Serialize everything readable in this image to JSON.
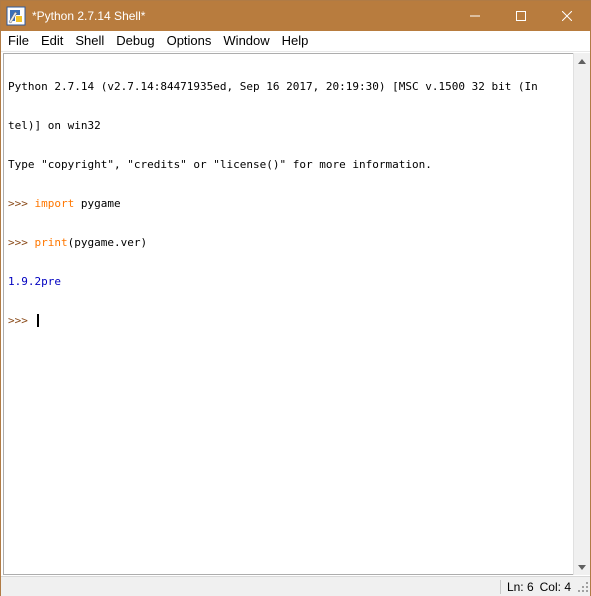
{
  "window": {
    "title": "*Python 2.7.14 Shell*",
    "titlebar_color": "#b87c3e"
  },
  "menu": {
    "items": [
      "File",
      "Edit",
      "Shell",
      "Debug",
      "Options",
      "Window",
      "Help"
    ]
  },
  "shell": {
    "banner_line1": "Python 2.7.14 (v2.7.14:84471935ed, Sep 16 2017, 20:19:30) [MSC v.1500 32 bit (In",
    "banner_line2": "tel)] on win32",
    "banner_line3": "Type \"copyright\", \"credits\" or \"license()\" for more information.",
    "prompt": ">>> ",
    "cmd1_keyword": "import",
    "cmd1_rest": " pygame",
    "cmd2_keyword": "print",
    "cmd2_rest": "(pygame.ver)",
    "output1": "1.9.2pre",
    "colors": {
      "prompt": "#8a4b1a",
      "keyword": "#ff7700",
      "output": "#0000c0"
    }
  },
  "status": {
    "line": "Ln: 6",
    "col": "Col: 4"
  },
  "icons": [
    "python-idle-icon",
    "minimize-icon",
    "maximize-icon",
    "close-icon",
    "scroll-up-icon",
    "scroll-down-icon",
    "resize-grip-icon"
  ]
}
